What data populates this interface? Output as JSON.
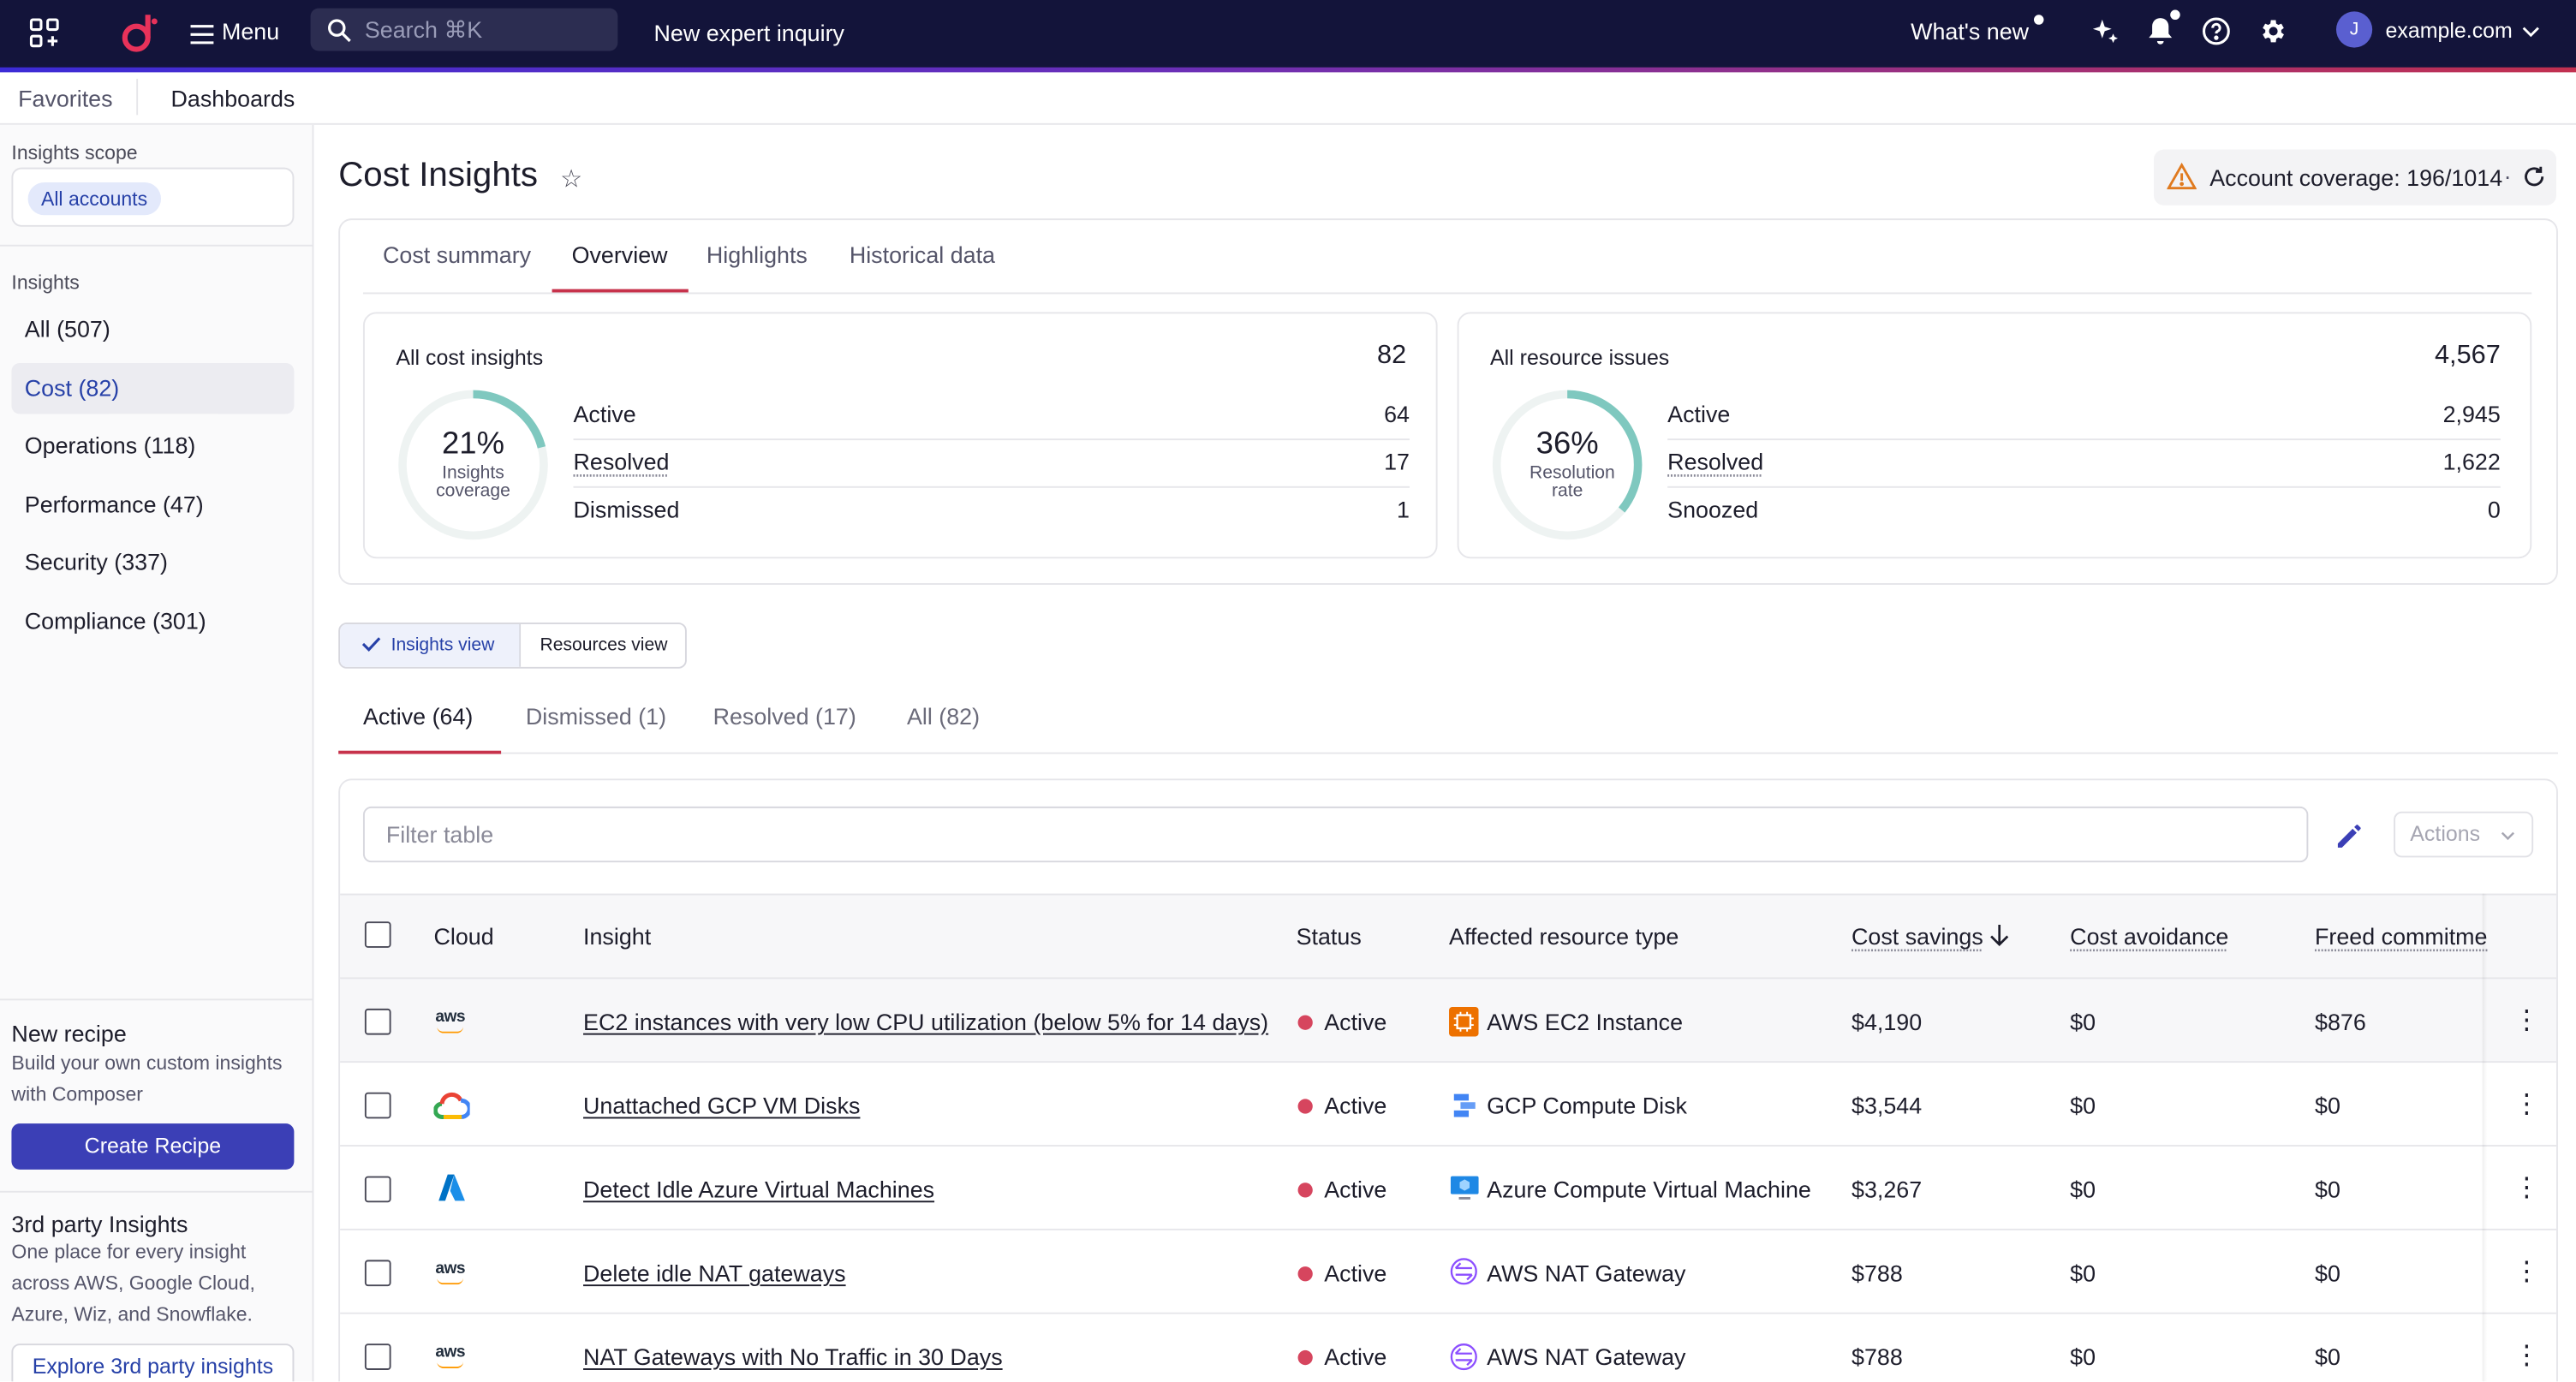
{
  "topbar": {
    "menu_label": "Menu",
    "search_placeholder": "Search ⌘K",
    "new_inquiry": "New expert inquiry",
    "whats_new": "What's new",
    "avatar_initial": "J",
    "account": "example.com"
  },
  "subnav": {
    "favorites": "Favorites",
    "dashboards": "Dashboards"
  },
  "sidebar": {
    "scope_label": "Insights scope",
    "scope_chip": "All accounts",
    "insights_label": "Insights",
    "items": [
      {
        "label": "All (507)"
      },
      {
        "label": "Cost (82)"
      },
      {
        "label": "Operations (118)"
      },
      {
        "label": "Performance (47)"
      },
      {
        "label": "Security (337)"
      },
      {
        "label": "Compliance (301)"
      }
    ],
    "recipe_title": "New recipe",
    "recipe_text": "Build your own custom insights with Composer",
    "recipe_button": "Create Recipe",
    "third_party_title": "3rd party Insights",
    "third_party_text": "One place for every insight across AWS, Google Cloud, Azure, Wiz, and Snowflake.",
    "third_party_button": "Explore 3rd party insights"
  },
  "page": {
    "title": "Cost Insights",
    "coverage": "Account coverage: 196/1014",
    "coverage_sep": "·"
  },
  "tabs": [
    "Cost summary",
    "Overview",
    "Highlights",
    "Historical data"
  ],
  "cards": {
    "cost": {
      "title": "All cost insights",
      "total": "82",
      "percent": "21%",
      "ring_label": "Insights coverage",
      "ring_fraction": 0.21,
      "rows": [
        {
          "label": "Active",
          "value": "64"
        },
        {
          "label": "Resolved",
          "value": "17"
        },
        {
          "label": "Dismissed",
          "value": "1"
        }
      ]
    },
    "resources": {
      "title": "All resource issues",
      "total": "4,567",
      "percent": "36%",
      "ring_label": "Resolution rate",
      "ring_fraction": 0.36,
      "rows": [
        {
          "label": "Active",
          "value": "2,945"
        },
        {
          "label": "Resolved",
          "value": "1,622"
        },
        {
          "label": "Snoozed",
          "value": "0"
        }
      ]
    }
  },
  "views": {
    "insights": "Insights view",
    "resources": "Resources view"
  },
  "subtabs": [
    "Active (64)",
    "Dismissed (1)",
    "Resolved (17)",
    "All (82)"
  ],
  "table": {
    "filter_placeholder": "Filter table",
    "actions_label": "Actions",
    "columns": [
      "Cloud",
      "Insight",
      "Status",
      "Affected resource type",
      "Cost savings",
      "Cost avoidance",
      "Freed commitme"
    ],
    "rows": [
      {
        "cloud": "aws",
        "insight": "EC2 instances with very low CPU utilization (below 5% for 14 days)",
        "status": "Active",
        "resource": "AWS EC2 Instance",
        "savings": "$4,190",
        "avoidance": "$0",
        "freed": "$876"
      },
      {
        "cloud": "gcp",
        "insight": "Unattached GCP VM Disks",
        "status": "Active",
        "resource": "GCP Compute Disk",
        "savings": "$3,544",
        "avoidance": "$0",
        "freed": "$0"
      },
      {
        "cloud": "azure",
        "insight": "Detect Idle Azure Virtual Machines",
        "status": "Active",
        "resource": "Azure Compute Virtual Machine",
        "savings": "$3,267",
        "avoidance": "$0",
        "freed": "$0"
      },
      {
        "cloud": "aws",
        "insight": "Delete idle NAT gateways",
        "status": "Active",
        "resource": "AWS NAT Gateway",
        "savings": "$788",
        "avoidance": "$0",
        "freed": "$0"
      },
      {
        "cloud": "aws",
        "insight": "NAT Gateways with No Traffic in 30 Days",
        "status": "Active",
        "resource": "AWS NAT Gateway",
        "savings": "$788",
        "avoidance": "$0",
        "freed": "$0"
      }
    ]
  },
  "colors": {
    "accent": "#3b3fb6",
    "brand": "#c7324b",
    "ring": "#7fc8bf",
    "status_active": "#d6455e",
    "topbar": "#13143a"
  }
}
